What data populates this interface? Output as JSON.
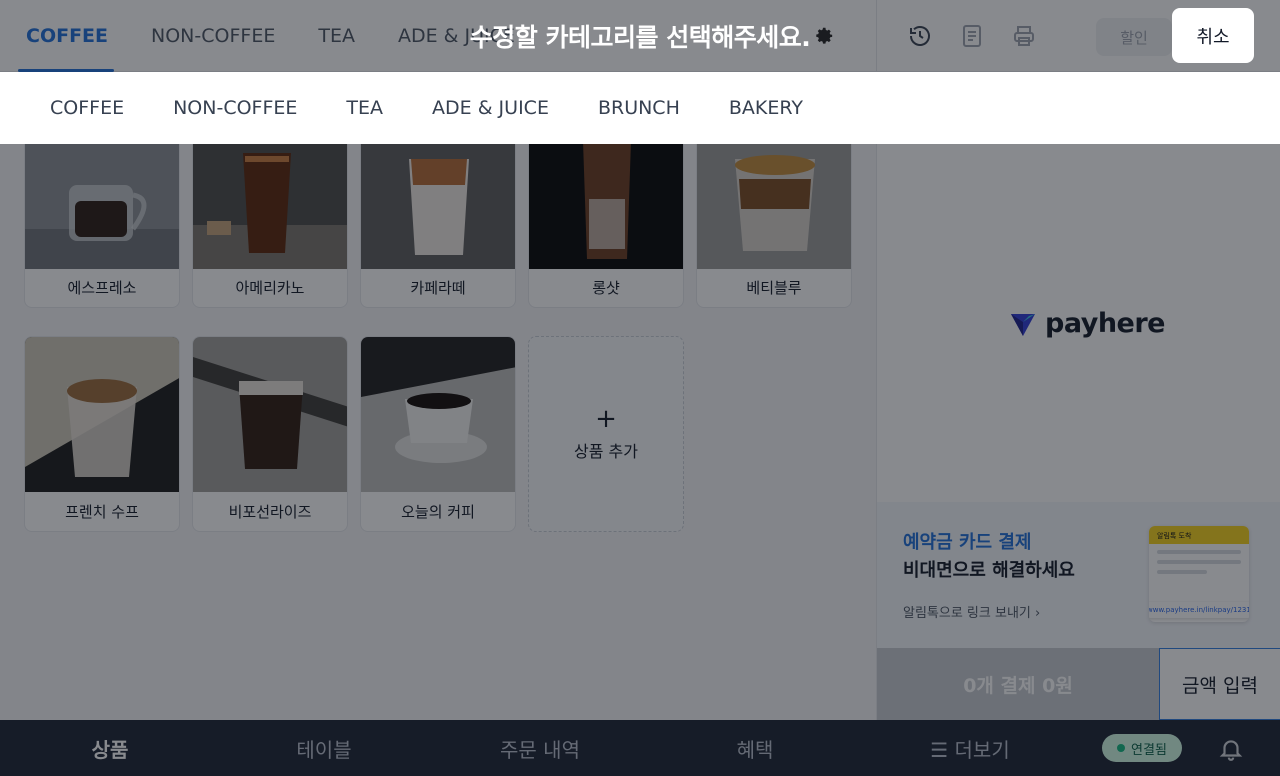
{
  "top_tabs": [
    "COFFEE",
    "NON-COFFEE",
    "TEA",
    "ADE & JUICE"
  ],
  "toolbar": {
    "discount_label": "할인"
  },
  "products": [
    {
      "name": "에스프레소",
      "photo": "espresso-glass"
    },
    {
      "name": "아메리카노",
      "photo": "iced-americano"
    },
    {
      "name": "카페라떼",
      "photo": "cafe-latte"
    },
    {
      "name": "롱샷",
      "photo": "long-shot"
    },
    {
      "name": "베티블루",
      "photo": "betty-blue"
    },
    {
      "name": "프렌치 수프",
      "photo": "french-soup"
    },
    {
      "name": "비포선라이즈",
      "photo": "before-sunrise"
    },
    {
      "name": "오늘의 커피",
      "photo": "coffee-cup"
    }
  ],
  "add_product": {
    "plus": "+",
    "label": "상품 추가"
  },
  "brand": {
    "logo_text": "payhere",
    "accent": "#2f3ad6"
  },
  "promo": {
    "title": "예약금 카드 결제",
    "subtitle": "비대면으로 해결하세요",
    "link": "알림톡으로 링크 보내기 ›",
    "phone_header": "알림톡 도착",
    "phone_url": "www.payhere.in/linkpay/123123"
  },
  "checkout": {
    "pay_label": "0개 결제 0원",
    "amount_label": "금액 입력"
  },
  "bottom_nav": [
    "상품",
    "테이블",
    "주문 내역",
    "혜택",
    "☰ 더보기"
  ],
  "connection": {
    "status": "연결됨"
  },
  "overlay": {
    "title": "수정할 카테고리를 선택해주세요.",
    "cancel_label": "취소",
    "categories": [
      "COFFEE",
      "NON-COFFEE",
      "TEA",
      "ADE & JUICE",
      "BRUNCH",
      "BAKERY"
    ]
  },
  "colors": {
    "primary": "#1e6fd9",
    "nav_bg": "#1a2233",
    "overlay": "rgba(18,22,30,0.5)"
  }
}
